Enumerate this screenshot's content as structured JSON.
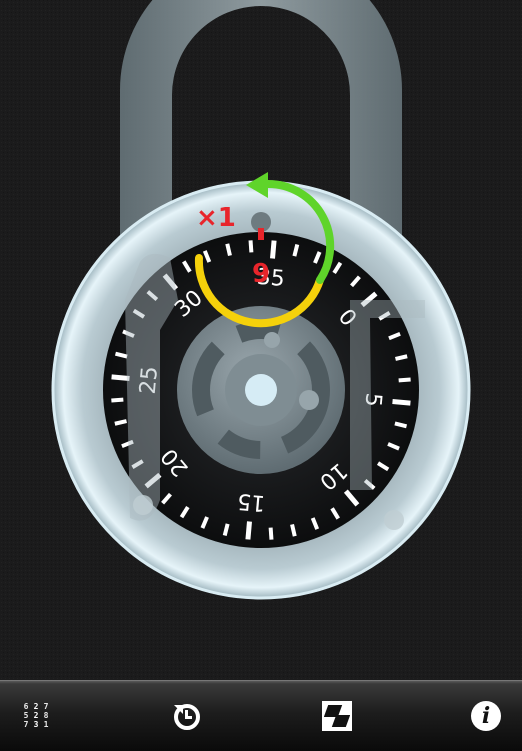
{
  "lock": {
    "dial_numbers": [
      "0",
      "5",
      "10",
      "15",
      "20",
      "25",
      "30",
      "35"
    ],
    "dial_max": 40,
    "dial_rotation_deg": 50,
    "current_number": "9",
    "rotation_count": "×1",
    "rotation_direction": "counterclockwise"
  },
  "colors": {
    "background": "#1a1a1b",
    "shackle": "#8d9aa0",
    "body_rim": "#cfe8f2",
    "dial_face": "#111214",
    "arc_yellow": "#f5d10b",
    "arc_green": "#5fd42a",
    "indicator_red": "#e8252b",
    "tick_white": "#ffffff"
  },
  "toolbar": {
    "combo_digits": [
      [
        "6",
        "2",
        "7"
      ],
      [
        "5",
        "2",
        "8"
      ],
      [
        "7",
        "3",
        "1"
      ]
    ],
    "items": [
      {
        "name": "combination-button",
        "icon": "combination-grid-icon"
      },
      {
        "name": "reset-button",
        "icon": "reset-arrow-icon"
      },
      {
        "name": "switch-lock-button",
        "icon": "swap-image-icon"
      },
      {
        "name": "info-button",
        "icon": "info-icon",
        "label": "i"
      }
    ]
  }
}
